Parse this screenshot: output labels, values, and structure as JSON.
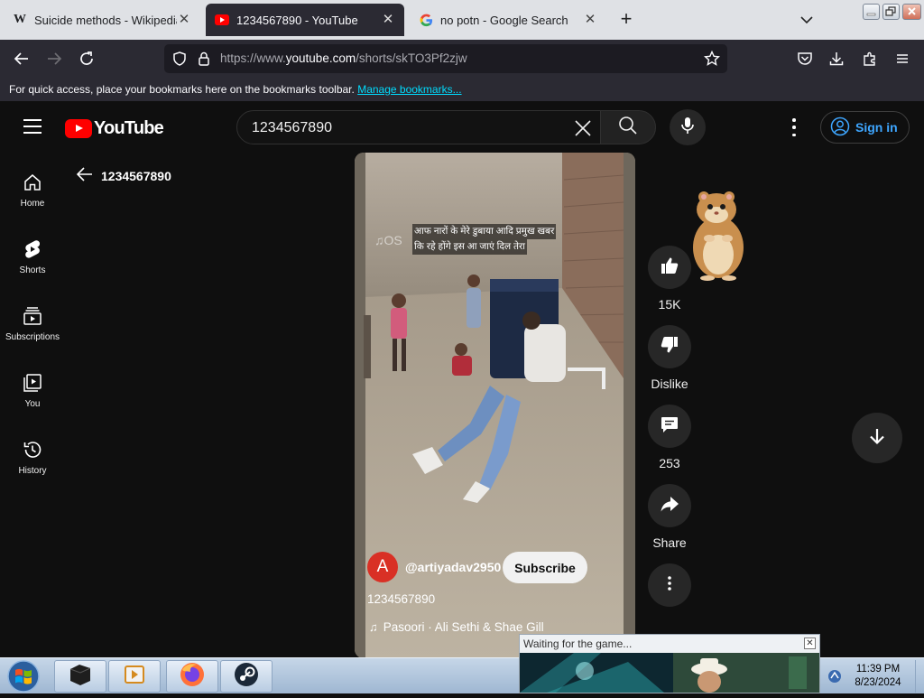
{
  "browser": {
    "tabs": [
      {
        "label": "Suicide methods - Wikipedia",
        "icon": "wikipedia-icon"
      },
      {
        "label": "1234567890 - YouTube",
        "icon": "youtube-icon",
        "active": true
      },
      {
        "label": "no potn - Google Search",
        "icon": "google-icon"
      }
    ],
    "url_prefix": "https://www.",
    "url_domain": "youtube.com",
    "url_path": "/shorts/skTO3Pf2zjw",
    "bookmarks_text": "For quick access, place your bookmarks here on the bookmarks toolbar.",
    "bookmarks_link": "Manage bookmarks..."
  },
  "youtube": {
    "logo": "YouTube",
    "search_value": "1234567890",
    "sign_in": "Sign in",
    "sidebar": [
      {
        "label": "Home",
        "icon": "home-icon"
      },
      {
        "label": "Shorts",
        "icon": "shorts-icon"
      },
      {
        "label": "Subscriptions",
        "icon": "subscriptions-icon"
      },
      {
        "label": "You",
        "icon": "you-icon"
      },
      {
        "label": "History",
        "icon": "history-icon"
      }
    ],
    "back_label": "1234567890",
    "short": {
      "caption_line1": "आफ नारों के मेरे डुबाया आदि प्रमुख खबर",
      "caption_line2": "कि रहे होंगे इस आ जाएं दिल तेरा",
      "channel_initial": "A",
      "channel_handle": "@artiyadav2950",
      "subscribe": "Subscribe",
      "title": "1234567890",
      "music": "Pasoori · Ali Sethi & Shae Gill"
    },
    "actions": {
      "likes": "15K",
      "dislike": "Dislike",
      "comments": "253",
      "share": "Share"
    }
  },
  "popup": {
    "title": "Waiting for the game..."
  },
  "taskbar": {
    "time": "11:39 PM",
    "date": "8/23/2024"
  },
  "colors": {
    "yt_bg": "#0f0f0f",
    "yt_red": "#ff0000",
    "link_blue": "#3ea6ff",
    "chrome_dark": "#2b2a33"
  }
}
